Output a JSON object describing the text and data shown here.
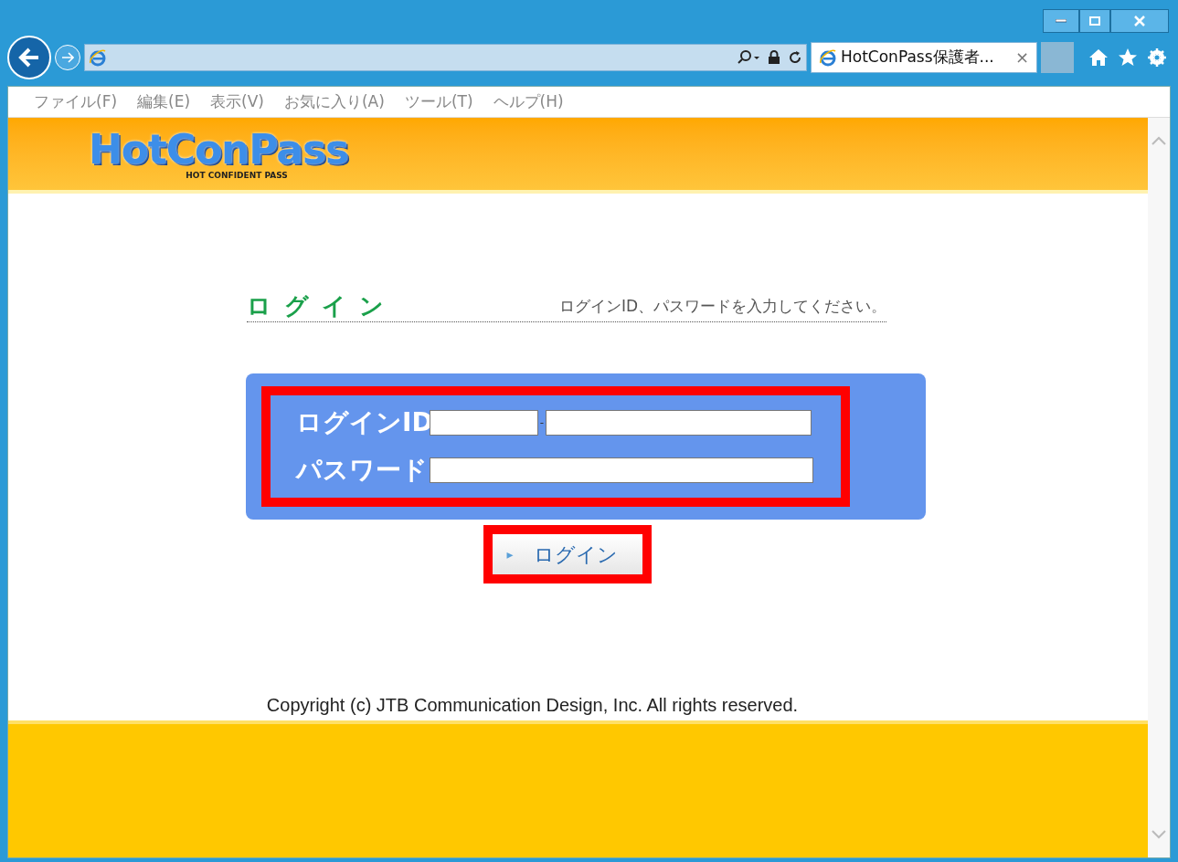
{
  "browser": {
    "tab_title": "HotConPass保護者...",
    "tab_close": "×",
    "menu": [
      "ファイル(F)",
      "編集(E)",
      "表示(V)",
      "お気に入り(A)",
      "ツール(T)",
      "ヘルプ(H)"
    ]
  },
  "logo": {
    "title": "HotConPass",
    "subtitle": "HOT CONFIDENT PASS"
  },
  "login": {
    "heading": "ログイン",
    "instruction": "ログインID、パスワードを入力してください。",
    "fields": [
      {
        "label": "ログインID",
        "kind": "split",
        "separator": "-"
      },
      {
        "label": "パスワード",
        "kind": "single"
      }
    ],
    "button": {
      "marker": "▸",
      "label": "ログイン"
    }
  },
  "footer": {
    "copyright": "Copyright (c) JTB Communication Design, Inc. All rights reserved."
  }
}
